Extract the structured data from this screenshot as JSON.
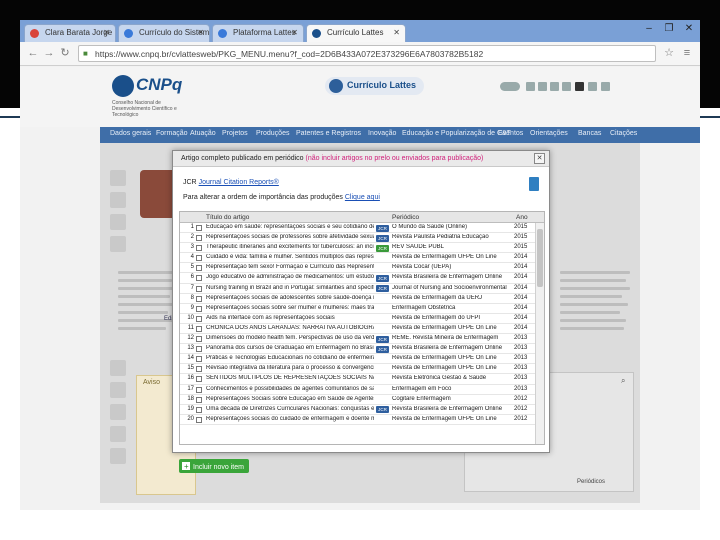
{
  "browser": {
    "tabs": [
      {
        "label": "Clara Barata Jorge",
        "favicon_color": "#d9443a"
      },
      {
        "label": "Currículo do Sistema Cu",
        "favicon_color": "#3a7ad9"
      },
      {
        "label": "Plataforma Lattes",
        "favicon_color": "#3a7ad9"
      },
      {
        "label": "Currículo Lattes",
        "favicon_color": "#1a4f8a"
      }
    ],
    "url": "https://www.cnpq.br/cvlattesweb/PKG_MENU.menu?f_cod=2D6B433A072E373296E6A7803782B5182",
    "window_controls": [
      "–",
      "❐",
      "✕"
    ]
  },
  "site": {
    "logo": "CNPq",
    "logo_sub": "Conselho Nacional de Desenvolvimento Científico e Tecnológico",
    "lattes_badge": "Currículo Lattes",
    "menu": [
      "Dados gerais",
      "Formação",
      "Atuação",
      "Projetos",
      "Produções",
      "Patentes e Registros",
      "Inovação",
      "Educação e Popularização de C&T",
      "Eventos",
      "Orientações",
      "Bancas",
      "Citações"
    ]
  },
  "modal": {
    "title": "Artigo completo publicado em periódico",
    "title_hint": "(não incluir artigos no prelo ou enviados para publicação)",
    "jcr_prefix": "JCR",
    "jcr_link": "Journal Citation Reports®",
    "order_text": "Para alterar a ordem de importância das produções",
    "order_link": "Clique aqui",
    "columns": {
      "title": "Título do artigo",
      "journal": "Periódico",
      "year": "Ano"
    },
    "rows": [
      {
        "n": "1",
        "title": "Educação em saúde: representações sociais e seu cotidiano de prática",
        "jcr": "JCR",
        "journal": "O Mundo da Saúde (Online)",
        "year": "2015"
      },
      {
        "n": "2",
        "title": "Representações sociais de professores sobre afetividade sexual",
        "jcr": "JCR",
        "journal": "Revista Paulista Pediatria Educação",
        "year": "2015"
      },
      {
        "n": "3",
        "title": "Therapeutic itineraries and excitements for tuberculosis: an incidence",
        "jcr": "JCR",
        "journal": "REV SAUDE PUBL",
        "year": "2015"
      },
      {
        "n": "4",
        "title": "Cuidado e vida: família e mulher. Sentidos múltiplos das representações",
        "jcr": "",
        "journal": "Revista de Enfermagem UFPE On Line",
        "year": "2014"
      },
      {
        "n": "5",
        "title": "Representação tem sexo! Formação e Currículo das Representações",
        "jcr": "",
        "journal": "Revista Cocar (UEPA)",
        "year": "2014"
      },
      {
        "n": "6",
        "title": "Jogo educativo de administração de medicamentos: um estudo de",
        "jcr": "JCR",
        "journal": "Revista Brasileira de Enfermagem Online",
        "year": "2014"
      },
      {
        "n": "7",
        "title": "Nursing training in Brazil and in Portugal: similarities and specificities",
        "jcr": "JCR",
        "journal": "Journal of Nursing and Socioenvironmental",
        "year": "2014"
      },
      {
        "n": "8",
        "title": "Representações sociais de adolescentes sobre saúde-doença mental",
        "jcr": "",
        "journal": "Revista de Enfermagem da UERJ",
        "year": "2014"
      },
      {
        "n": "9",
        "title": "Representações sociais sobre ser mulher e mulheres: mães trabalhadoras",
        "jcr": "",
        "journal": "Enfermagem Obstétrica",
        "year": "2014"
      },
      {
        "n": "10",
        "title": "Aids na interface com as representações sociais",
        "jcr": "",
        "journal": "Revista de Enfermagem do UFPI",
        "year": "2014"
      },
      {
        "n": "11",
        "title": "CRÔNICA DOS ANOS LARANJAS: NARRATIVA AUTOBIOGRÁFICA",
        "jcr": "",
        "journal": "Revista de Enfermagem UFPE On Line",
        "year": "2014"
      },
      {
        "n": "12",
        "title": "Dimensões do modelo health fem. Perspectivas de uso da verdade",
        "jcr": "JCR",
        "journal": "REME. Revista Mineira de Enfermagem",
        "year": "2013"
      },
      {
        "n": "13",
        "title": "Panorama dos cursos de Graduação em Enfermagem no Brasil na",
        "jcr": "JCR",
        "journal": "Revista Brasileira de Enfermagem Online",
        "year": "2013"
      },
      {
        "n": "14",
        "title": "Práticas e Tecnologias Educacionais no cotidiano de enfermeiras da",
        "jcr": "",
        "journal": "Revista de Enfermagem UFPE On Line",
        "year": "2013"
      },
      {
        "n": "15",
        "title": "Revisão integrativa da literatura para o processo & convergências",
        "jcr": "",
        "journal": "Revista de Enfermagem UFPE On Line",
        "year": "2013"
      },
      {
        "n": "16",
        "title": "SENTIDOS MÚLTIPLOS DE REPRESENTAÇÕES SOCIAIS NA",
        "jcr": "",
        "journal": "Revista Eletrônica Gestão & Saúde",
        "year": "2013"
      },
      {
        "n": "17",
        "title": "Conhecimentos e possibilidades de agentes comunitários de saúde",
        "jcr": "",
        "journal": "Enfermagem em Foco",
        "year": "2013"
      },
      {
        "n": "18",
        "title": "Representações Sociais sobre Educação em Saúde de Agentes Comunitários",
        "jcr": "",
        "journal": "Cogitare Enfermagem",
        "year": "2012"
      },
      {
        "n": "19",
        "title": "Uma década de Diretrizes Curriculares Nacionais: conquistas e desafios",
        "jcr": "JCR",
        "journal": "Revista Brasileira de Enfermagem Online",
        "year": "2012"
      },
      {
        "n": "20",
        "title": "Representações sociais do cuidado de enfermagem e doente mental",
        "jcr": "",
        "journal": "Revista de Enfermagem UFPE On Line",
        "year": "2012"
      }
    ],
    "jcr_green_row": 3,
    "add_button": "Incluir novo item",
    "accent_green": "#3aa53a"
  },
  "background": {
    "warn_title": "Aviso",
    "bottom_text": "Periódicos",
    "update_text": "Editar Resumo"
  }
}
